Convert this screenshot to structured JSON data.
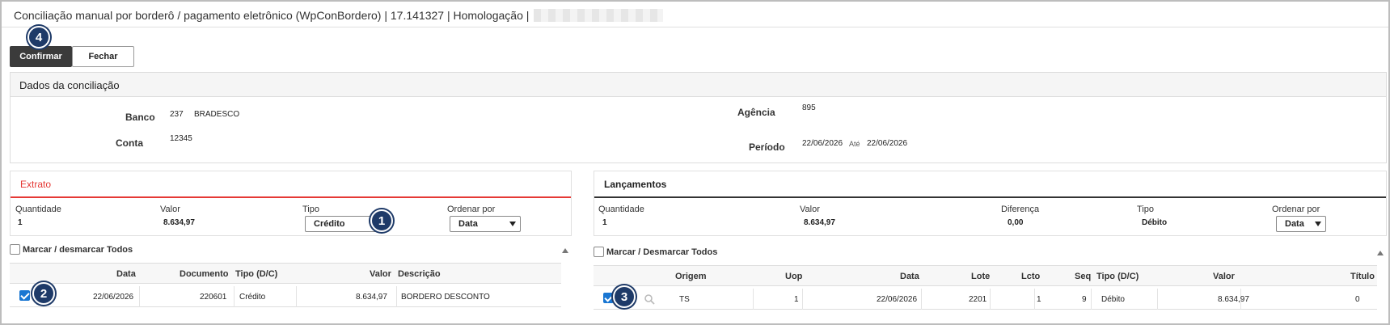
{
  "window": {
    "title": "Conciliação manual por borderô / pagamento eletrônico (WpConBordero) | 17.141327 | Homologação |"
  },
  "toolbar": {
    "confirm_label": "Confirmar",
    "close_label": "Fechar"
  },
  "badges": {
    "b1": "1",
    "b2": "2",
    "b3": "3",
    "b4": "4"
  },
  "dados": {
    "title": "Dados da conciliação",
    "banco_label": "Banco",
    "banco_code": "237",
    "banco_name": "BRADESCO",
    "conta_label": "Conta",
    "conta_value": "12345",
    "agencia_label": "Agência",
    "agencia_value": "895",
    "periodo_label": "Período",
    "periodo_start": "22/06/2026",
    "periodo_ate": "Até",
    "periodo_end": "22/06/2026"
  },
  "extrato": {
    "title": "Extrato",
    "accent": "#e53935",
    "quantidade_label": "Quantidade",
    "quantidade_value": "1",
    "valor_label": "Valor",
    "valor_value": "8.634,97",
    "tipo_label": "Tipo",
    "tipo_value": "Crédito",
    "ordenar_label": "Ordenar por",
    "ordenar_value": "Data",
    "mark_all_label": "Marcar / desmarcar Todos",
    "columns": {
      "data": "Data",
      "documento": "Documento",
      "tipo": "Tipo (D/C)",
      "valor": "Valor",
      "descricao": "Descrição"
    },
    "rows": [
      {
        "checked": true,
        "data": "22/06/2026",
        "documento": "220601",
        "tipo": "Crédito",
        "valor": "8.634,97",
        "descricao": "BORDERO DESCONTO"
      }
    ]
  },
  "lancamentos": {
    "title": "Lançamentos",
    "quantidade_label": "Quantidade",
    "quantidade_value": "1",
    "valor_label": "Valor",
    "valor_value": "8.634,97",
    "diferenca_label": "Diferença",
    "diferenca_value": "0,00",
    "tipo_label": "Tipo",
    "tipo_value": "Débito",
    "ordenar_label": "Ordenar por",
    "ordenar_value": "Data",
    "mark_all_label": "Marcar / Desmarcar Todos",
    "columns": {
      "origem": "Origem",
      "uop": "Uop",
      "data": "Data",
      "lote": "Lote",
      "lcto": "Lcto",
      "seq": "Seq",
      "tipo": "Tipo (D/C)",
      "valor": "Valor",
      "titulo": "Título"
    },
    "rows": [
      {
        "checked": true,
        "origem": "TS",
        "uop": "1",
        "data": "22/06/2026",
        "lote": "2201",
        "lcto": "1",
        "seq": "9",
        "tipo": "Débito",
        "valor": "8.634,97",
        "titulo": "0"
      }
    ]
  }
}
